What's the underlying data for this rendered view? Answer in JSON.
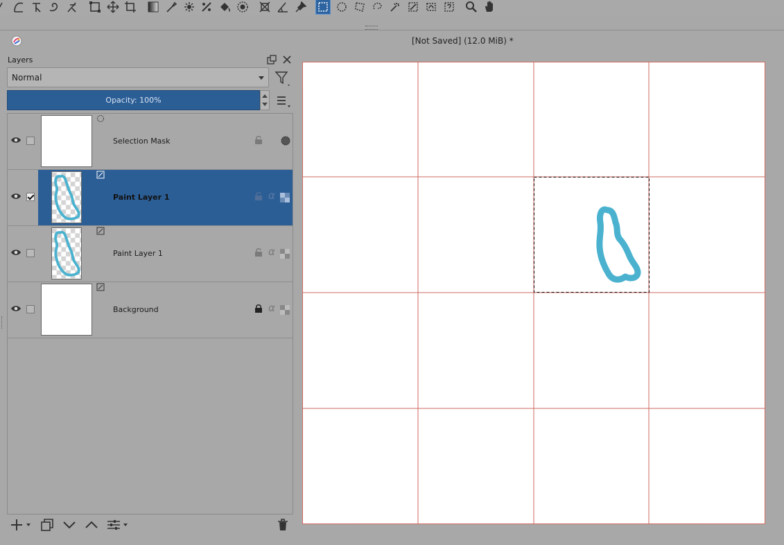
{
  "toolbar": {
    "tools": [
      {
        "icon": "bezier-curve-icon"
      },
      {
        "icon": "dynamic-brush-icon"
      },
      {
        "icon": "freehand-path-icon"
      },
      {
        "icon": "multibrush-icon"
      },
      {
        "icon": "transform-icon"
      },
      {
        "icon": "move-icon"
      },
      {
        "icon": "crop-icon"
      },
      {
        "icon": "gradient-icon"
      },
      {
        "icon": "color-picker-icon"
      },
      {
        "icon": "smart-patch-icon"
      },
      {
        "icon": "fill-icon"
      },
      {
        "icon": "enclose-fill-icon"
      },
      {
        "icon": "assistant-icon"
      },
      {
        "icon": "measure-icon"
      },
      {
        "icon": "reference-icon"
      },
      {
        "icon": "rectangular-selection-icon",
        "active": true
      },
      {
        "icon": "elliptical-selection-icon"
      },
      {
        "icon": "polygonal-selection-icon"
      },
      {
        "icon": "freehand-selection-icon"
      },
      {
        "icon": "contiguous-selection-icon"
      },
      {
        "icon": "similar-color-selection-icon"
      },
      {
        "icon": "bezier-selection-icon"
      },
      {
        "icon": "magnetic-selection-icon"
      },
      {
        "icon": "zoom-icon"
      },
      {
        "icon": "pan-icon"
      }
    ]
  },
  "document": {
    "title": "[Not Saved]  (12.0 MiB) *"
  },
  "layers_docker": {
    "title": "Layers",
    "blend_mode": "Normal",
    "opacity_label": "Opacity:  100%",
    "layers": [
      {
        "name": "Selection Mask",
        "visible": true,
        "checked": false,
        "selected": false,
        "type": "selection-mask"
      },
      {
        "name": "Paint Layer 1",
        "visible": true,
        "checked": true,
        "selected": true,
        "type": "paint"
      },
      {
        "name": "Paint Layer 1",
        "visible": true,
        "checked": false,
        "selected": false,
        "type": "paint"
      },
      {
        "name": "Background",
        "visible": true,
        "checked": false,
        "selected": false,
        "type": "background",
        "locked": true
      }
    ]
  },
  "colors": {
    "accent": "#2c5e96",
    "stroke": "#4ab2cf",
    "grid": "#c0392b"
  }
}
